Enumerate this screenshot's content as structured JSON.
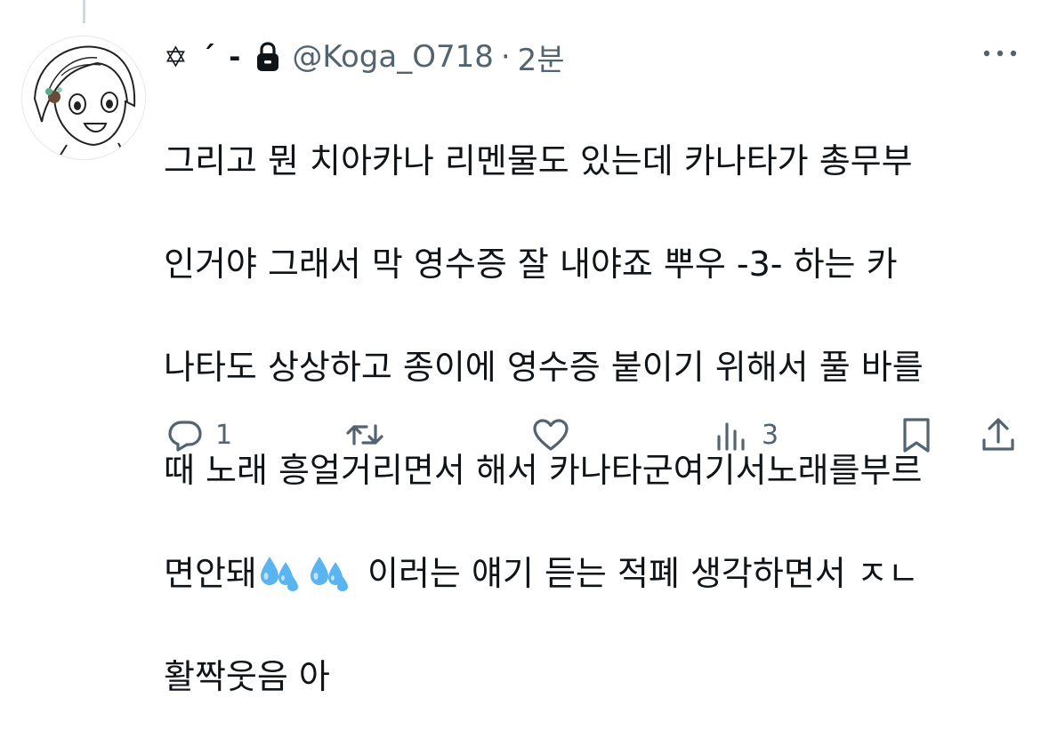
{
  "tweet": {
    "display_name": "✡︎ ´ -",
    "handle": "@Koga_O718",
    "separator": "·",
    "time": "2분",
    "text_lines": [
      "그리고 뭔 치아카나 리멘물도 있는데 카나타가 총무부",
      "인거야 그래서 막 영수증 잘 내야죠 뿌우 -3- 하는 카",
      "나타도 상상하고 종이에 영수증 붙이기 위해서 풀 바를",
      "때 노래 흥얼거리면서 해서 카나타군여기서노래를부르",
      "면안돼",
      "이러는 얘기 듣는 적폐 생각하면서 ㅈㄴ",
      "활짝웃음 아"
    ],
    "emoji_names": [
      "sweat-droplets-emoji",
      "sweat-droplets-emoji"
    ]
  },
  "actions": {
    "reply_count": "1",
    "retweet_count": "",
    "like_count": "",
    "views_count": "3"
  },
  "icons": {
    "lock": "lock-icon",
    "more": "more-icon",
    "reply": "reply-icon",
    "retweet": "retweet-icon",
    "like": "like-icon",
    "views": "views-icon",
    "bookmark": "bookmark-icon",
    "share": "share-icon"
  },
  "colors": {
    "text": "#0f1419",
    "secondary": "#536471",
    "thread_line": "#cfd9de",
    "emoji_blue": "#5ab4f0"
  }
}
